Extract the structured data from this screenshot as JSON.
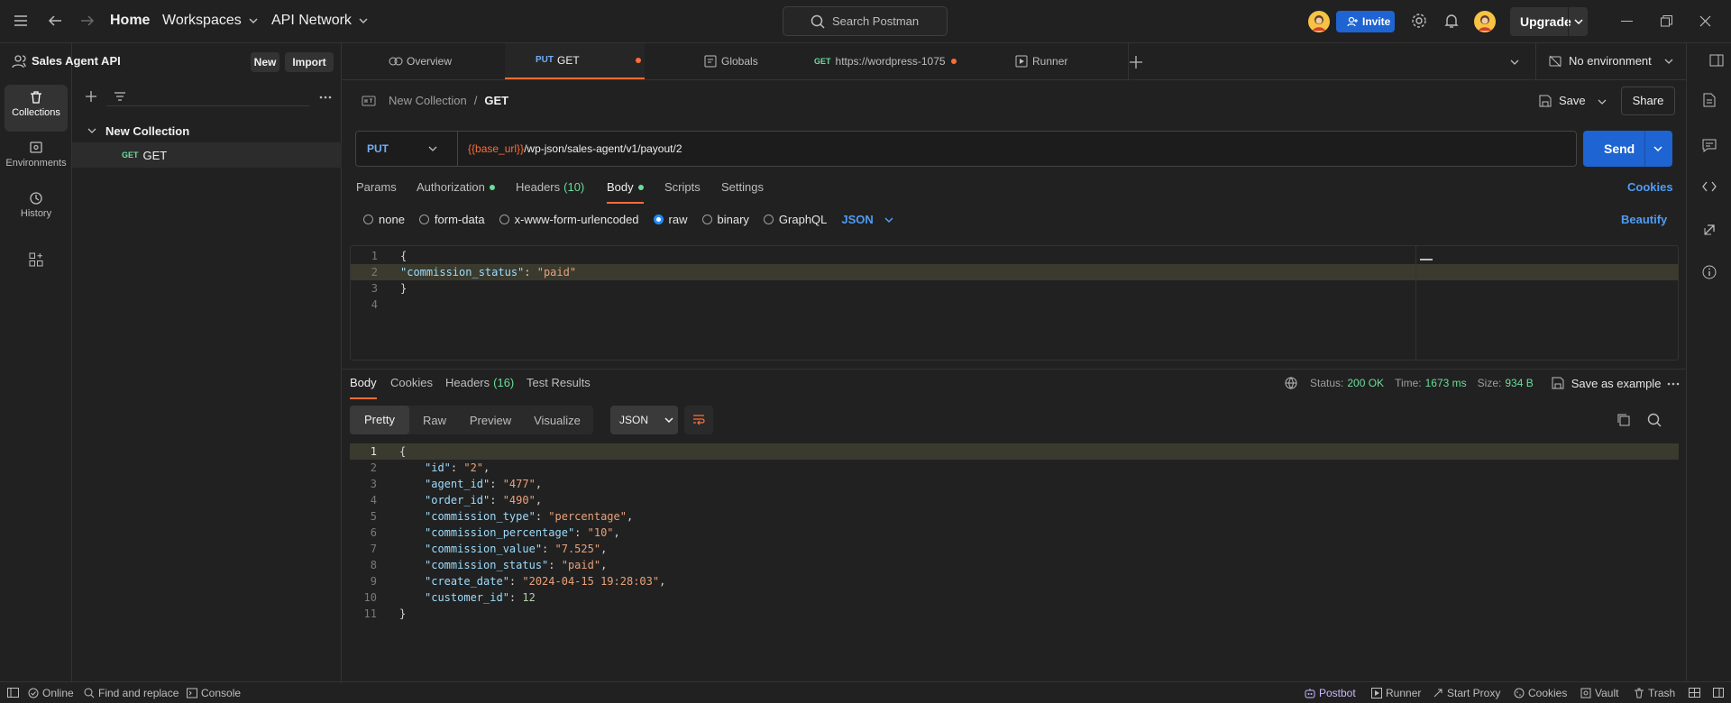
{
  "topbar": {
    "home": "Home",
    "workspaces": "Workspaces",
    "api_network": "API Network",
    "search_placeholder": "Search Postman",
    "invite": "Invite",
    "upgrade": "Upgrade"
  },
  "rail": {
    "collections": "Collections",
    "environments": "Environments",
    "history": "History"
  },
  "sidebar": {
    "workspace_name": "Sales Agent API",
    "new_btn": "New",
    "import_btn": "Import",
    "collection_name": "New Collection",
    "request_method": "GET",
    "request_name": "GET"
  },
  "tabs": [
    {
      "label": "Overview"
    },
    {
      "method": "PUT",
      "label": "GET"
    },
    {
      "label": "Globals"
    },
    {
      "method": "GET",
      "label": "https://wordpress-1075"
    },
    {
      "label": "Runner"
    }
  ],
  "environment": "No environment",
  "request": {
    "breadcrumb_parent": "New Collection",
    "breadcrumb_sep": "/",
    "breadcrumb_current": "GET",
    "save": "Save",
    "share": "Share",
    "method": "PUT",
    "url_var": "{{base_url}}",
    "url_path": "/wp-json/sales-agent/v1/payout/2",
    "send": "Send",
    "subtabs": {
      "params": "Params",
      "authorization": "Authorization",
      "headers": "Headers",
      "headers_count": "(10)",
      "body": "Body",
      "scripts": "Scripts",
      "settings": "Settings",
      "cookies": "Cookies"
    },
    "body_types": {
      "none": "none",
      "form_data": "form-data",
      "urlencoded": "x-www-form-urlencoded",
      "raw": "raw",
      "binary": "binary",
      "graphql": "GraphQL",
      "format": "JSON",
      "beautify": "Beautify"
    },
    "body_lines": [
      "{",
      "\"commission_status\": \"paid\"",
      "}",
      ""
    ]
  },
  "response": {
    "tabs": {
      "body": "Body",
      "cookies": "Cookies",
      "headers": "Headers",
      "headers_count": "(16)",
      "test_results": "Test Results"
    },
    "status_label": "Status:",
    "status_value": "200 OK",
    "time_label": "Time:",
    "time_value": "1673 ms",
    "size_label": "Size:",
    "size_value": "934 B",
    "save_example": "Save as example",
    "view_modes": {
      "pretty": "Pretty",
      "raw": "Raw",
      "preview": "Preview",
      "visualize": "Visualize",
      "format": "JSON"
    },
    "lines": [
      {
        "t": "{"
      },
      {
        "key": "id",
        "str": "2"
      },
      {
        "key": "agent_id",
        "str": "477"
      },
      {
        "key": "order_id",
        "str": "490"
      },
      {
        "key": "commission_type",
        "str": "percentage"
      },
      {
        "key": "commission_percentage",
        "str": "10"
      },
      {
        "key": "commission_value",
        "str": "7.525"
      },
      {
        "key": "commission_status",
        "str": "paid"
      },
      {
        "key": "create_date",
        "str": "2024-04-15 19:28:03"
      },
      {
        "key": "customer_id",
        "num": "12"
      },
      {
        "t": "}"
      }
    ]
  },
  "statusbar": {
    "online": "Online",
    "find_replace": "Find and replace",
    "console": "Console",
    "postbot": "Postbot",
    "runner": "Runner",
    "start_proxy": "Start Proxy",
    "cookies": "Cookies",
    "vault": "Vault",
    "trash": "Trash"
  },
  "colors": {
    "accent_orange": "#ff6c37",
    "primary_blue": "#1e64d2",
    "status_green": "#6bdd9a"
  }
}
